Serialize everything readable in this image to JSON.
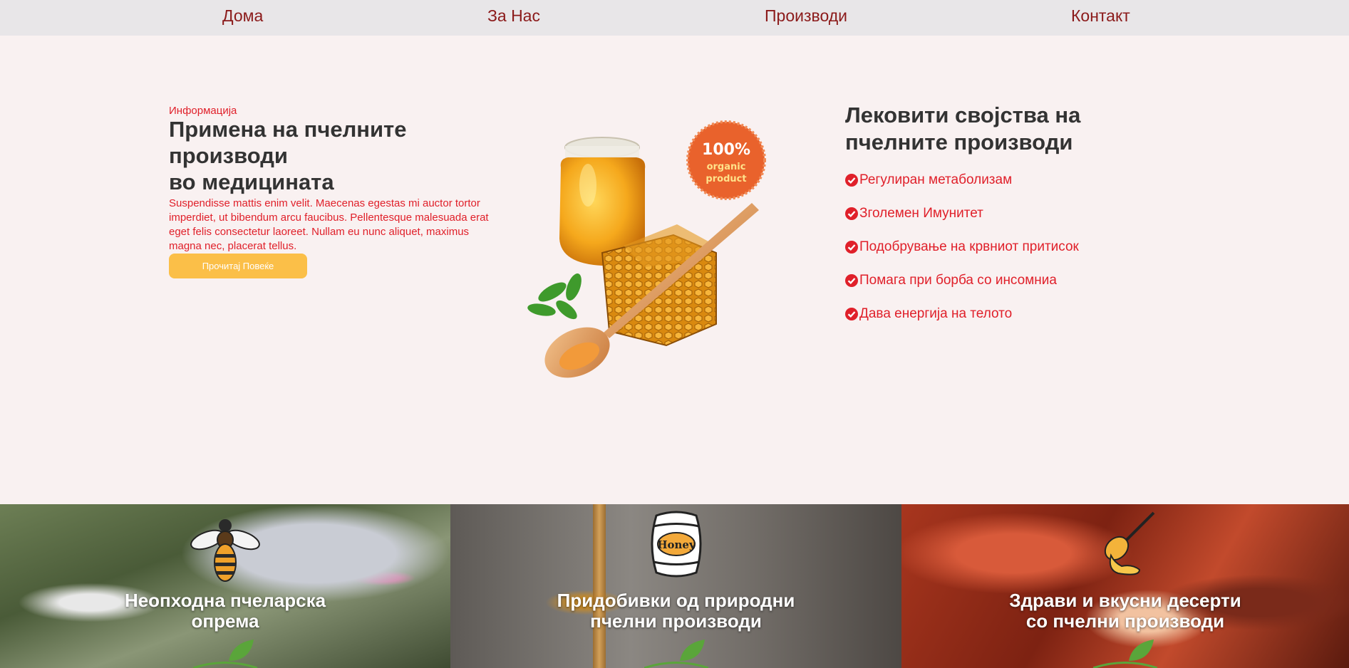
{
  "nav": {
    "items": [
      {
        "label": "Дома"
      },
      {
        "label": "За Нас"
      },
      {
        "label": "Производи"
      },
      {
        "label": "Контакт"
      }
    ]
  },
  "info": {
    "eyebrow": "Информација",
    "title_lines": [
      "Примена на пчелните",
      "производи",
      "во медицината"
    ],
    "body": "Suspendisse mattis enim velit. Maecenas egestas mi auctor tortor imperdiet, ut bibendum arcu faucibus. Pellentesque malesuada erat eget felis consectetur laoreet. Nullam eu nunc aliquet, maximus magna nec, placerat tellus.",
    "button_label": "Прочитај Повеќе"
  },
  "hero": {
    "badge_percent": "100%",
    "badge_line1": "organic",
    "badge_line2": "product"
  },
  "properties": {
    "title_lines": [
      "Лековити својства на",
      "пчелните производи"
    ],
    "items": [
      {
        "label": "Регулиран метаболизам"
      },
      {
        "label": "Зголемен Имунитет"
      },
      {
        "label": "Подобрување на крвниот притисок"
      },
      {
        "label": "Помага при борба со инсомниа"
      },
      {
        "label": "Дава енергија на телото"
      }
    ]
  },
  "tiles": [
    {
      "lines": [
        "Неопходна пчеларска",
        "опрема"
      ],
      "icon": "bee-icon"
    },
    {
      "lines": [
        "Придобивки од природни",
        "пчелни производи"
      ],
      "icon": "honey-barrel-icon",
      "barrel_text": "Honey"
    },
    {
      "lines": [
        "Здрави и вкусни десерти",
        "со пчелни производи"
      ],
      "icon": "honey-dipper-icon"
    }
  ],
  "colors": {
    "accent": "#e0202a",
    "nav_text": "#8b1a1a",
    "button": "#fbbf48",
    "page_bg": "#f9f1f1"
  }
}
